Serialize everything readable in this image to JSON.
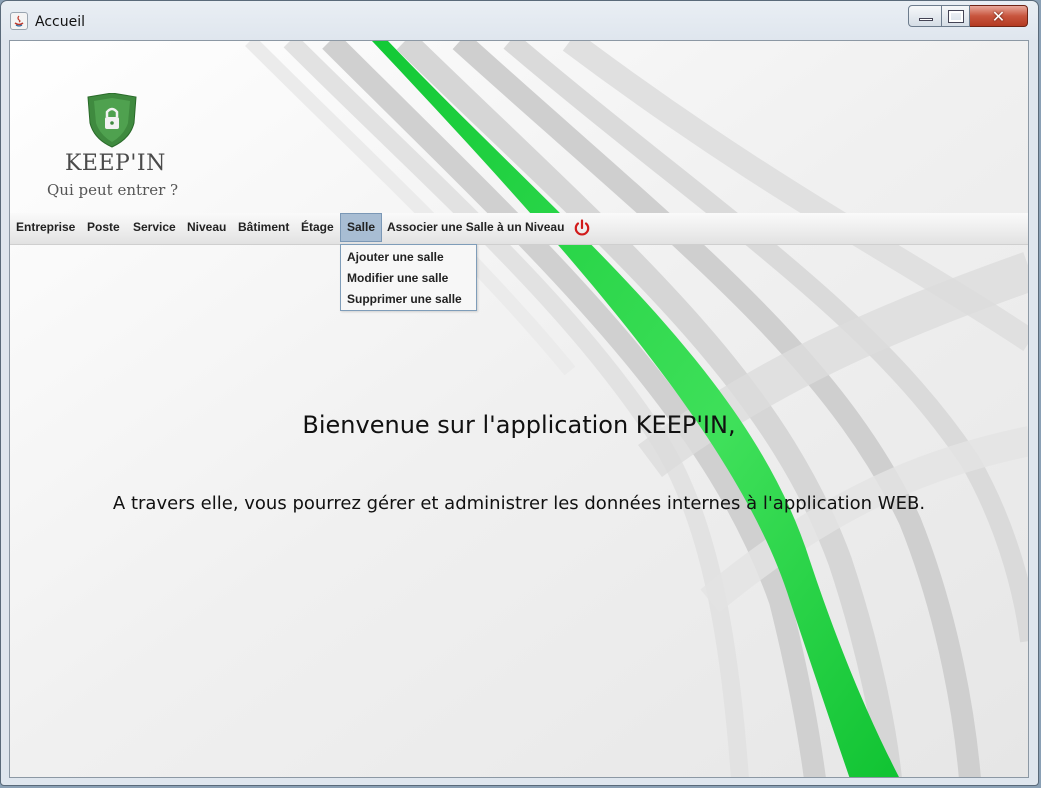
{
  "window": {
    "title": "Accueil",
    "close_glyph": "✕"
  },
  "logo": {
    "icon": "shield-lock-icon",
    "title": "KEEP'IN",
    "subtitle": "Qui peut entrer ?"
  },
  "menu": {
    "items": [
      {
        "label": "Entreprise"
      },
      {
        "label": "Poste"
      },
      {
        "label": "Service"
      },
      {
        "label": "Niveau"
      },
      {
        "label": "Bâtiment"
      },
      {
        "label": "Étage"
      },
      {
        "label": "Salle",
        "active": true
      },
      {
        "label": "Associer une Salle à un Niveau"
      }
    ],
    "power_icon": "power-icon"
  },
  "dropdown": {
    "items": [
      {
        "label": "Ajouter une salle"
      },
      {
        "label": "Modifier une salle"
      },
      {
        "label": "Supprimer une salle"
      }
    ]
  },
  "main": {
    "welcome": "Bienvenue sur l'application KEEP'IN,",
    "description": "A travers elle, vous pourrez gérer et administrer les données internes à l'application WEB."
  },
  "colors": {
    "accent_green": "#1ad13c",
    "menu_active": "#a8bdd3",
    "power_red": "#d11a1a"
  }
}
